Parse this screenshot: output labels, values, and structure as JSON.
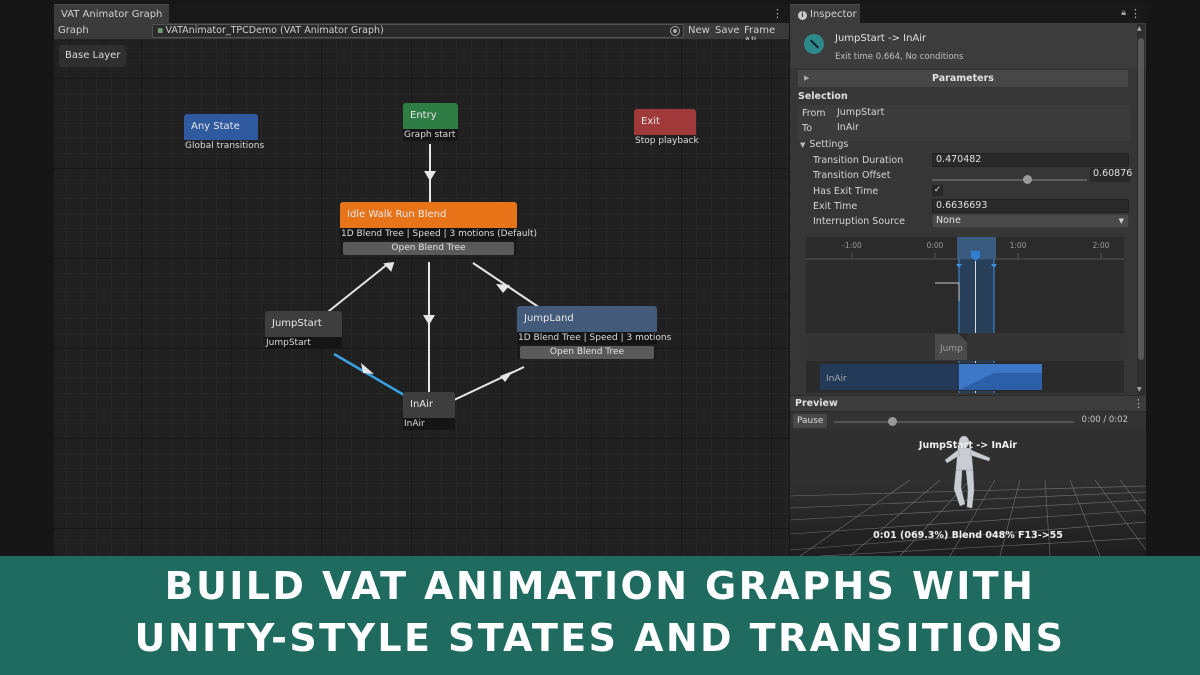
{
  "graph_window": {
    "tab_title": "VAT Animator Graph",
    "graph_label": "Graph",
    "asset_value": "VATAnimator_TPCDemo (VAT Animator Graph)",
    "buttons": {
      "new": "New",
      "save": "Save",
      "frame_all": "Frame All"
    },
    "layer_button": "Base Layer"
  },
  "nodes": {
    "any_state": {
      "title": "Any State",
      "subtitle": "Global transitions",
      "color": "#2f5aa0"
    },
    "entry": {
      "title": "Entry",
      "subtitle": "Graph start",
      "color": "#2e7d45"
    },
    "exit": {
      "title": "Exit",
      "subtitle": "Stop playback",
      "color": "#a0393a"
    },
    "idle_walk_run": {
      "title": "Idle Walk Run Blend",
      "subtitle": "1D Blend Tree | Speed | 3 motions (Default)",
      "button": "Open Blend Tree",
      "color": "#e77419"
    },
    "jump_start": {
      "title": "JumpStart",
      "subtitle": "JumpStart",
      "color": "#3e3e3e"
    },
    "jump_land": {
      "title": "JumpLand",
      "subtitle": "1D Blend Tree | Speed | 3 motions",
      "button": "Open Blend Tree",
      "color": "#445a7a"
    },
    "in_air": {
      "title": "InAir",
      "subtitle": "InAir",
      "color": "#3e3e3e"
    }
  },
  "inspector": {
    "tab_title": "Inspector",
    "title": "JumpStart -> InAir",
    "detail": "Exit time 0.664, No conditions",
    "parameters_label": "Parameters",
    "selection_label": "Selection",
    "from_label": "From",
    "from_value": "JumpStart",
    "to_label": "To",
    "to_value": "InAir",
    "settings_label": "Settings",
    "transition_duration_label": "Transition Duration",
    "transition_duration_value": "0.470482",
    "transition_offset_label": "Transition Offset",
    "transition_offset_value": "0.60876",
    "transition_offset_fraction": 0.61,
    "has_exit_time_label": "Has Exit Time",
    "has_exit_time_value": true,
    "exit_time_label": "Exit Time",
    "exit_time_value": "0.6636693",
    "interruption_source_label": "Interruption Source",
    "interruption_source_value": "None"
  },
  "timeline": {
    "ticks": [
      "-1:00",
      "0:00",
      "1:00",
      "2:00"
    ],
    "source_clip": "Jump",
    "target_clip": "InAir"
  },
  "preview": {
    "label": "Preview",
    "pause_label": "Pause",
    "time": "0:00 / 0:02",
    "progress_fraction": 0.24,
    "viewport_title": "JumpStart -> InAir",
    "viewport_status": "0:01 (069.3%) Blend 048% F13->55"
  },
  "banner": {
    "line1": "BUILD VAT ANIMATION GRAPHS WITH",
    "line2": "UNITY-STYLE STATES AND TRANSITIONS"
  },
  "colors": {
    "banner_bg": "#1f6b5f",
    "selected_transition": "#3aa0e0",
    "timeline_highlight": "#2f7fd0"
  }
}
